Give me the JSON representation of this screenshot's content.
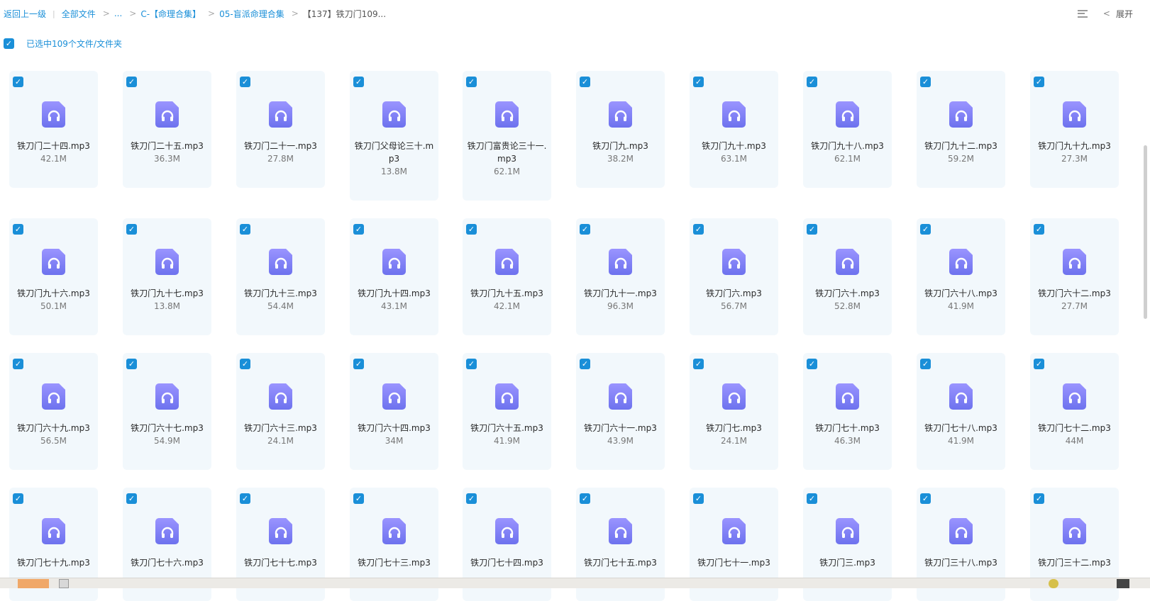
{
  "breadcrumb": {
    "back": "返回上一级",
    "items": [
      "全部文件",
      "...",
      "C-【命理合集】",
      "05-盲派命理合集"
    ],
    "current": "【137】铁刀门109..."
  },
  "top_right": {
    "expand_label": "展开"
  },
  "selection": {
    "text": "已选中109个文件/文件夹",
    "checked": true
  },
  "files": [
    {
      "name": "铁刀门二十四.mp3",
      "size": "42.1M"
    },
    {
      "name": "铁刀门二十五.mp3",
      "size": "36.3M"
    },
    {
      "name": "铁刀门二十一.mp3",
      "size": "27.8M"
    },
    {
      "name": "铁刀门父母论三十.mp3",
      "size": "13.8M"
    },
    {
      "name": "铁刀门富贵论三十一.mp3",
      "size": "62.1M"
    },
    {
      "name": "铁刀门九.mp3",
      "size": "38.2M"
    },
    {
      "name": "铁刀门九十.mp3",
      "size": "63.1M"
    },
    {
      "name": "铁刀门九十八.mp3",
      "size": "62.1M"
    },
    {
      "name": "铁刀门九十二.mp3",
      "size": "59.2M"
    },
    {
      "name": "铁刀门九十九.mp3",
      "size": "27.3M"
    },
    {
      "name": "铁刀门九十六.mp3",
      "size": "50.1M"
    },
    {
      "name": "铁刀门九十七.mp3",
      "size": "13.8M"
    },
    {
      "name": "铁刀门九十三.mp3",
      "size": "54.4M"
    },
    {
      "name": "铁刀门九十四.mp3",
      "size": "43.1M"
    },
    {
      "name": "铁刀门九十五.mp3",
      "size": "42.1M"
    },
    {
      "name": "铁刀门九十一.mp3",
      "size": "96.3M"
    },
    {
      "name": "铁刀门六.mp3",
      "size": "56.7M"
    },
    {
      "name": "铁刀门六十.mp3",
      "size": "52.8M"
    },
    {
      "name": "铁刀门六十八.mp3",
      "size": "41.9M"
    },
    {
      "name": "铁刀门六十二.mp3",
      "size": "27.7M"
    },
    {
      "name": "铁刀门六十九.mp3",
      "size": "56.5M"
    },
    {
      "name": "铁刀门六十七.mp3",
      "size": "54.9M"
    },
    {
      "name": "铁刀门六十三.mp3",
      "size": "24.1M"
    },
    {
      "name": "铁刀门六十四.mp3",
      "size": "34M"
    },
    {
      "name": "铁刀门六十五.mp3",
      "size": "41.9M"
    },
    {
      "name": "铁刀门六十一.mp3",
      "size": "43.9M"
    },
    {
      "name": "铁刀门七.mp3",
      "size": "24.1M"
    },
    {
      "name": "铁刀门七十.mp3",
      "size": "46.3M"
    },
    {
      "name": "铁刀门七十八.mp3",
      "size": "41.9M"
    },
    {
      "name": "铁刀门七十二.mp3",
      "size": "44M"
    },
    {
      "name": "铁刀门七十九.mp3",
      "size": ""
    },
    {
      "name": "铁刀门七十六.mp3",
      "size": ""
    },
    {
      "name": "铁刀门七十七.mp3",
      "size": ""
    },
    {
      "name": "铁刀门七十三.mp3",
      "size": ""
    },
    {
      "name": "铁刀门七十四.mp3",
      "size": ""
    },
    {
      "name": "铁刀门七十五.mp3",
      "size": ""
    },
    {
      "name": "铁刀门七十一.mp3",
      "size": ""
    },
    {
      "name": "铁刀门三.mp3",
      "size": ""
    },
    {
      "name": "铁刀门三十八.mp3",
      "size": ""
    },
    {
      "name": "铁刀门三十二.mp3",
      "size": ""
    }
  ],
  "colors": {
    "accent": "#1a8fd8",
    "card_bg": "#f2f8fc",
    "icon_top": "#9a94ff",
    "icon_bottom": "#6d72ee"
  },
  "icons": {
    "file": "headphones-file-icon",
    "check": "check-icon"
  }
}
